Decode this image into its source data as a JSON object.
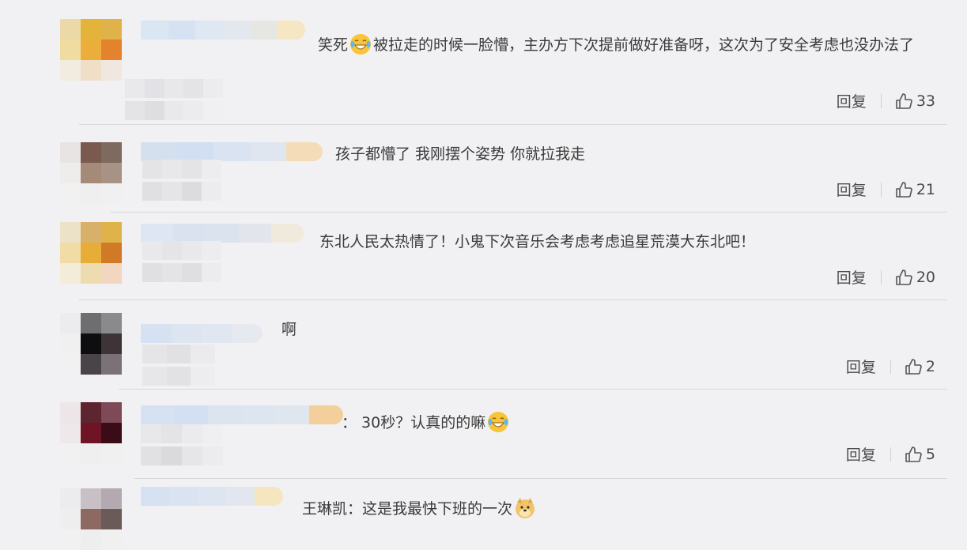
{
  "comments": [
    {
      "text_a": "笑死",
      "text_b": "被拉走的时候一脸懵，主办方下次提前做好准备呀，这次为了安全考虑也没办法了",
      "reply_label": "回复",
      "like_count": "33",
      "emoji": "laughing-crying-icon"
    },
    {
      "text": "孩子都懵了 我刚摆个姿势 你就拉我走",
      "reply_label": "回复",
      "like_count": "21"
    },
    {
      "text": "东北人民太热情了！小鬼下次音乐会考虑考虑追星荒漠大东北吧！",
      "reply_label": "回复",
      "like_count": "20"
    },
    {
      "text": "啊",
      "reply_label": "回复",
      "like_count": "2"
    },
    {
      "text": "：  30秒？认真的的嘛",
      "reply_label": "回复",
      "like_count": "5",
      "emoji": "laughing-crying-icon"
    },
    {
      "text": "王琳凯：这是我最快下班的一次",
      "emoji": "doge-icon"
    }
  ],
  "colors": {
    "background": "#f1f1f3",
    "text": "#3a3a3a",
    "divider": "#d8d8dc"
  }
}
